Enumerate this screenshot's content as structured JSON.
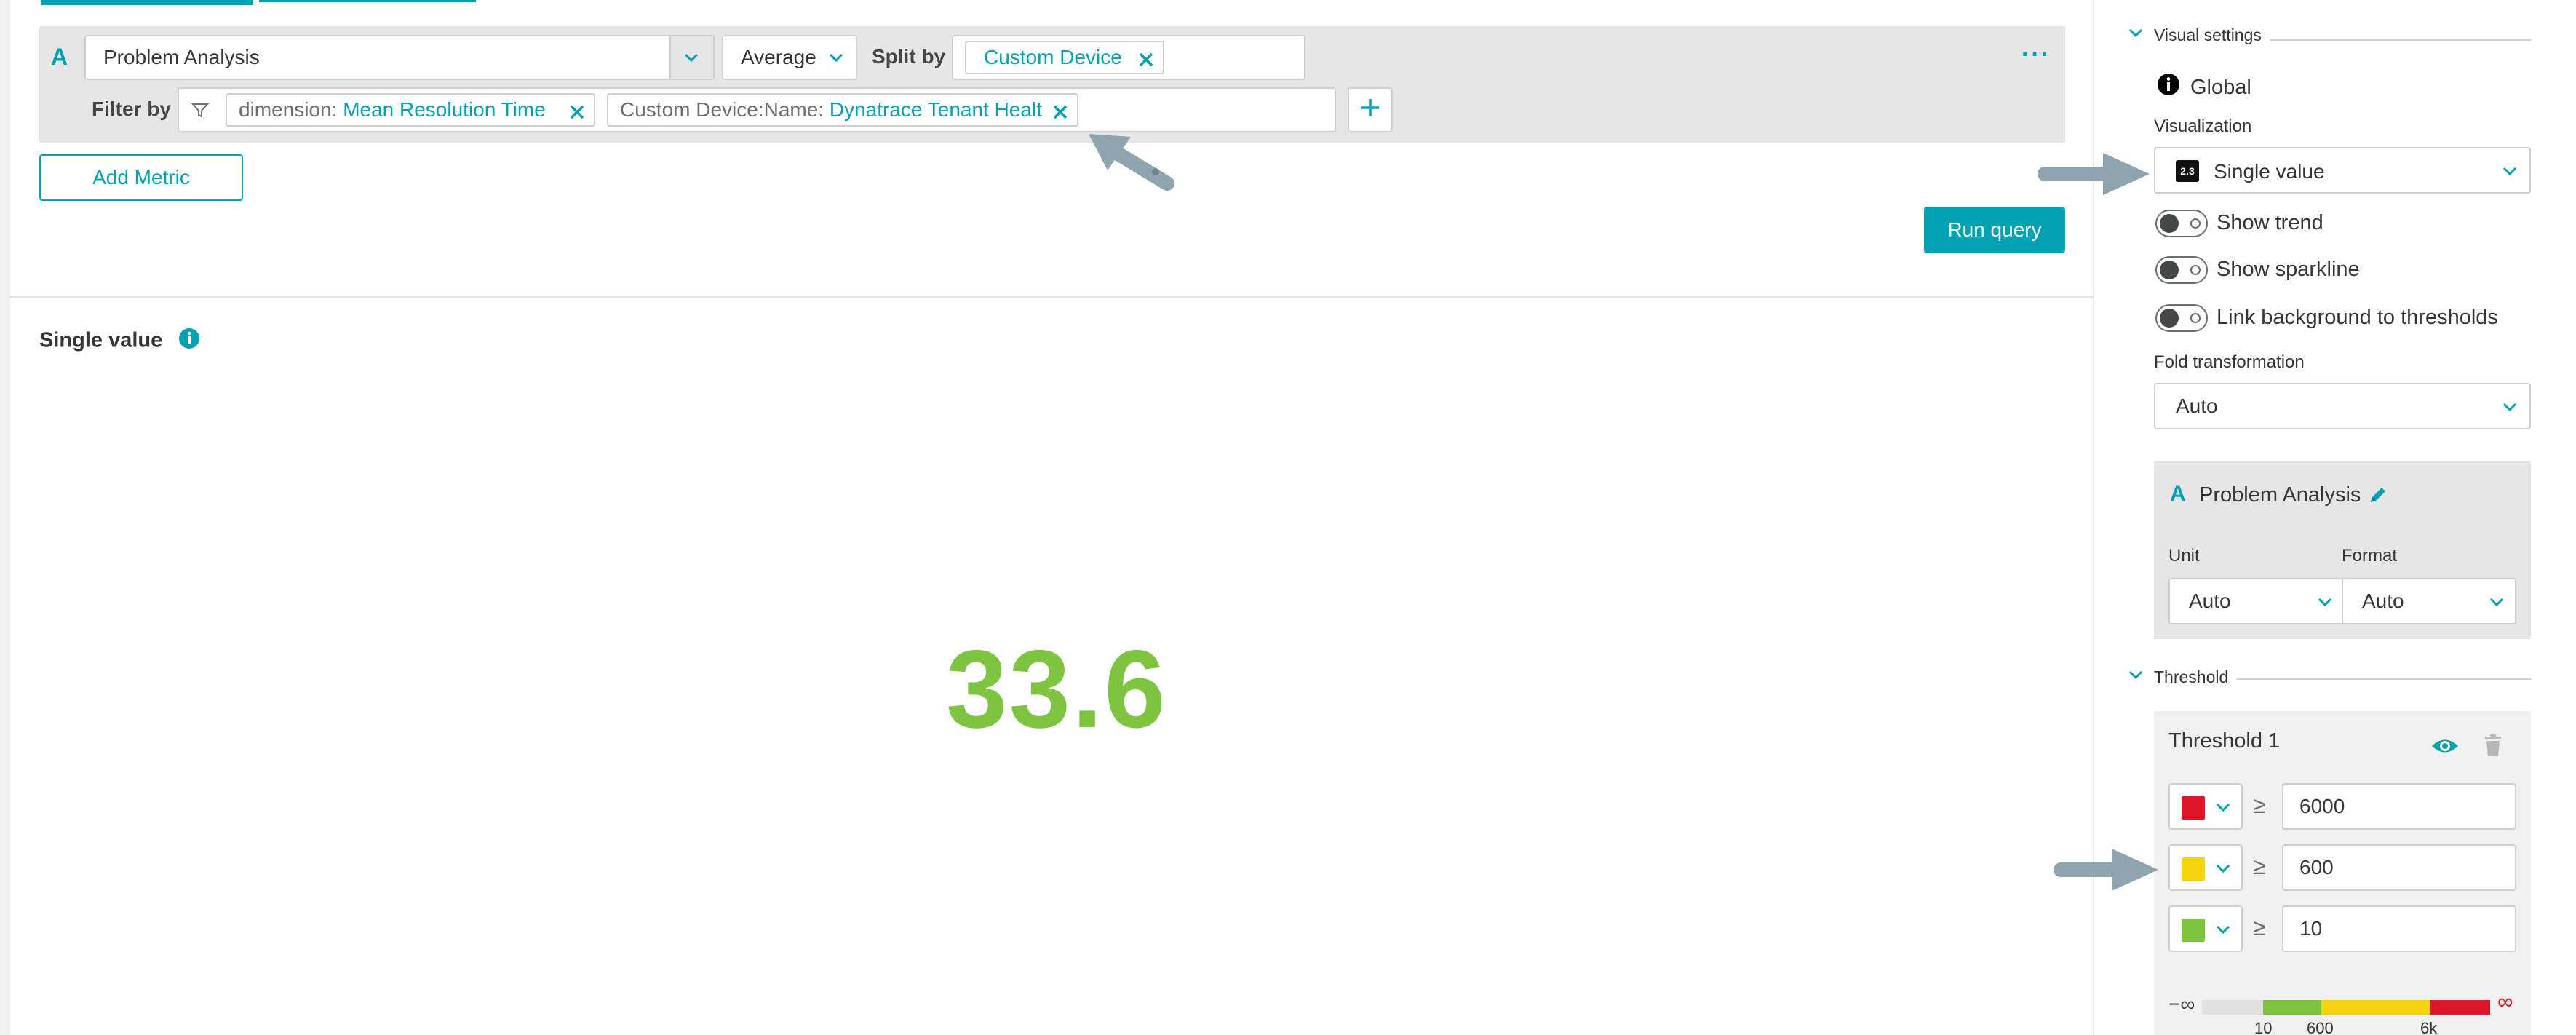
{
  "query": {
    "row_letter": "A",
    "metric": "Problem Analysis",
    "aggregation": "Average",
    "split_by_label": "Split by",
    "split_by_chip": "Custom Device",
    "filter_by_label": "Filter by",
    "filters": [
      {
        "key": "dimension:",
        "value": "Mean Resolution Time"
      },
      {
        "key": "Custom Device:Name:",
        "value": "Dynatrace Tenant Healt"
      }
    ],
    "more": "···"
  },
  "buttons": {
    "add_metric": "Add Metric",
    "run_query": "Run query"
  },
  "visualization": {
    "title": "Single value",
    "value": "33.6"
  },
  "sidebar": {
    "visual_settings": "Visual settings",
    "global": "Global",
    "visualization_label": "Visualization",
    "visualization_icon_text": "2.3",
    "visualization_value": "Single value",
    "toggles": [
      "Show trend",
      "Show sparkline",
      "Link background to thresholds"
    ],
    "fold_label": "Fold transformation",
    "fold_value": "Auto",
    "metric_letter": "A",
    "metric_name": "Problem Analysis",
    "unit_label": "Unit",
    "unit_value": "Auto",
    "format_label": "Format",
    "format_value": "Auto",
    "threshold_section": "Threshold",
    "threshold_title": "Threshold 1",
    "thresholds": [
      {
        "color": "#dc172a",
        "op": "≥",
        "value": "6000"
      },
      {
        "color": "#f5d30f",
        "op": "≥",
        "value": "600"
      },
      {
        "color": "#7dc540",
        "op": "≥",
        "value": "10"
      }
    ],
    "scale": {
      "neg_inf": "−∞",
      "pos_inf": "∞",
      "ticks": [
        "10",
        "600",
        "6k"
      ]
    }
  },
  "colors": {
    "accent": "#00a1b2",
    "value_green": "#7dc540",
    "red": "#dc172a",
    "yellow": "#f5d30f",
    "gray": "#e0e0e0"
  }
}
